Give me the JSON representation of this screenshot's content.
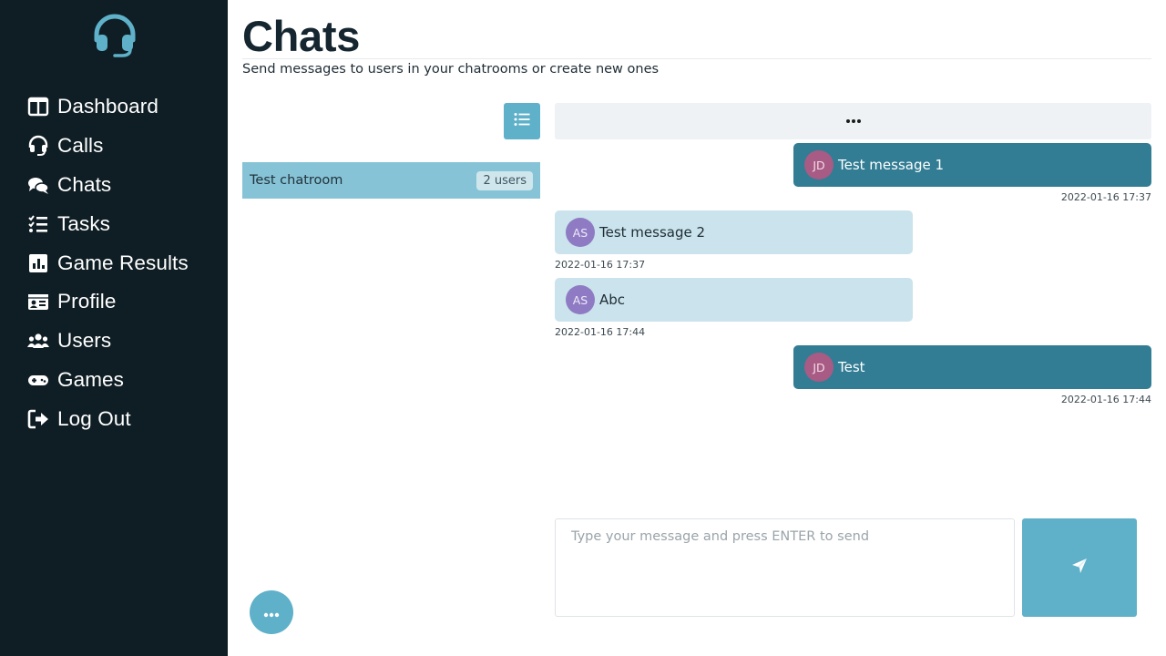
{
  "app": {
    "logo_icon": "headset-icon",
    "accent_color": "#5fb0c9",
    "sidebar_color": "#0f1e24"
  },
  "sidebar": {
    "items": [
      {
        "label": "Dashboard",
        "icon": "dashboard-icon"
      },
      {
        "label": "Calls",
        "icon": "headset-icon"
      },
      {
        "label": "Chats",
        "icon": "comments-icon"
      },
      {
        "label": "Tasks",
        "icon": "tasks-icon"
      },
      {
        "label": "Game Results",
        "icon": "chart-icon"
      },
      {
        "label": "Profile",
        "icon": "id-card-icon"
      },
      {
        "label": "Users",
        "icon": "users-icon"
      },
      {
        "label": "Games",
        "icon": "gamepad-icon"
      },
      {
        "label": "Log Out",
        "icon": "logout-icon"
      }
    ]
  },
  "header": {
    "title": "Chats",
    "subtitle": "Send messages to users in your chatrooms or create new ones"
  },
  "chatrooms": {
    "list_button_icon": "list-icon",
    "items": [
      {
        "name": "Test chatroom",
        "badge": "2 users"
      }
    ],
    "fab_icon": "ellipsis-icon"
  },
  "chat": {
    "header_icon": "ellipsis-icon",
    "messages": [
      {
        "author_initials": "JD",
        "text": "Test message 1",
        "timestamp": "2022-01-16 17:37",
        "own": true
      },
      {
        "author_initials": "AS",
        "text": "Test message 2",
        "timestamp": "2022-01-16 17:37",
        "own": false
      },
      {
        "author_initials": "AS",
        "text": "Abc",
        "timestamp": "2022-01-16 17:44",
        "own": false
      },
      {
        "author_initials": "JD",
        "text": "Test",
        "timestamp": "2022-01-16 17:44",
        "own": true
      }
    ],
    "composer": {
      "placeholder": "Type your message and press ENTER to send",
      "value": ""
    },
    "send_icon": "paper-plane-icon"
  }
}
